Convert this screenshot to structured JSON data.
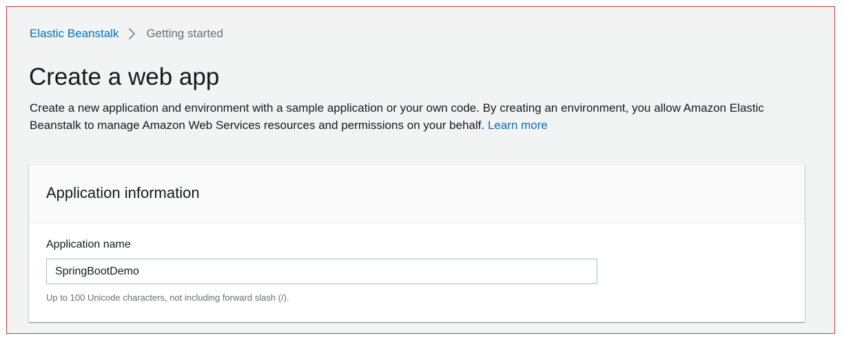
{
  "breadcrumb": {
    "items": [
      {
        "label": "Elastic Beanstalk"
      },
      {
        "label": "Getting started"
      }
    ]
  },
  "header": {
    "title": "Create a web app",
    "description": "Create a new application and environment with a sample application or your own code. By creating an environment, you allow Amazon Elastic Beanstalk to manage Amazon Web Services resources and permissions on your behalf.",
    "learn_more": "Learn more"
  },
  "panel": {
    "title": "Application information",
    "field": {
      "label": "Application name",
      "value": "SpringBootDemo",
      "constraint": "Up to 100 Unicode characters, not including forward slash (/)."
    }
  },
  "icons": {
    "breadcrumb_separator": "chevron-right-icon"
  },
  "colors": {
    "link": "#0073bb",
    "frame_border": "#c4373a",
    "page_background": "#f2f3f3"
  }
}
